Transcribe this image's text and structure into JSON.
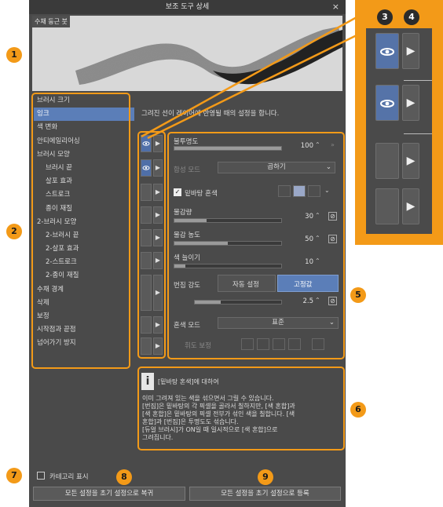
{
  "window": {
    "title": "보조 도구 상세",
    "close_icon": "×"
  },
  "preview": {
    "label": "수채 둥근 붓"
  },
  "categories": [
    {
      "label": "브러시 크기",
      "sub": false,
      "selected": false
    },
    {
      "label": "잉크",
      "sub": false,
      "selected": true
    },
    {
      "label": "색 변화",
      "sub": false,
      "selected": false
    },
    {
      "label": "안티에일리어싱",
      "sub": false,
      "selected": false
    },
    {
      "label": "브러시 모양",
      "sub": false,
      "selected": false
    },
    {
      "label": "브러시 끝",
      "sub": true,
      "selected": false
    },
    {
      "label": "살포 효과",
      "sub": true,
      "selected": false
    },
    {
      "label": "스트로크",
      "sub": true,
      "selected": false
    },
    {
      "label": "종이 재질",
      "sub": true,
      "selected": false
    },
    {
      "label": "2-브러시 모양",
      "sub": false,
      "selected": false
    },
    {
      "label": "2-브러시 끝",
      "sub": true,
      "selected": false
    },
    {
      "label": "2-살포 효과",
      "sub": true,
      "selected": false
    },
    {
      "label": "2-스트로크",
      "sub": true,
      "selected": false
    },
    {
      "label": "2-종이 재질",
      "sub": true,
      "selected": false
    },
    {
      "label": "수채 경계",
      "sub": false,
      "selected": false
    },
    {
      "label": "삭제",
      "sub": false,
      "selected": false
    },
    {
      "label": "보정",
      "sub": false,
      "selected": false
    },
    {
      "label": "시작점과 끝점",
      "sub": false,
      "selected": false
    },
    {
      "label": "넘어가기 방지",
      "sub": false,
      "selected": false
    }
  ],
  "settings": {
    "description": "그려진 선이 레이어에 반영될 때의 설정을 합니다.",
    "opacity": {
      "label": "불투명도",
      "value": "100",
      "fraction": 1.0
    },
    "blend_mode": {
      "label": "합성 모드",
      "value": "곱하기"
    },
    "mix_color": {
      "label": "밑바탕 혼색",
      "checked": "✓"
    },
    "paint_amount": {
      "label": "물감량",
      "value": "30",
      "fraction": 0.3
    },
    "paint_density": {
      "label": "물감 농도",
      "value": "50",
      "fraction": 0.5
    },
    "color_stretch": {
      "label": "색 늘이기",
      "value": "10",
      "fraction": 0.1
    },
    "blur": {
      "label": "번짐 강도",
      "auto_label": "자동 설정",
      "fixed_label": "고정값",
      "value": "2.5",
      "fraction": 0.3
    },
    "mix_mode": {
      "label": "혼색 모드",
      "value": "표준"
    },
    "brightness": {
      "label": "휘도 보정"
    }
  },
  "info": {
    "title": "[밑바탕 혼색]에 대하여",
    "lines": [
      "이미 그려져 있는 색을 섞으면서 그릴 수 있습니다.",
      "[번짐]은 밑바탕의 각 픽셀을 골라서 칠하지만, [색 혼합]과",
      "[색 혼합]은 밑바탕의 픽셀 전부가 섞인 색을 칠합니다. [색",
      "혼합]과 [번짐]은 투명도도 섞습니다.",
      "[듀얼 브러시]가 ON일 때 일시적으로 [색 혼합]으로",
      "그려집니다."
    ]
  },
  "footer": {
    "show_category": "카테고리 표시",
    "reset_button": "모든 설정을 초기 설정으로 복귀",
    "register_button": "모든 설정을 초기 설정으로 등록"
  },
  "badges": [
    "1",
    "2",
    "3",
    "4",
    "5",
    "6",
    "7",
    "8",
    "9"
  ],
  "colors": {
    "accent": "#f39a18",
    "selected": "#5b7eb8",
    "panel": "#4a4a4a"
  }
}
